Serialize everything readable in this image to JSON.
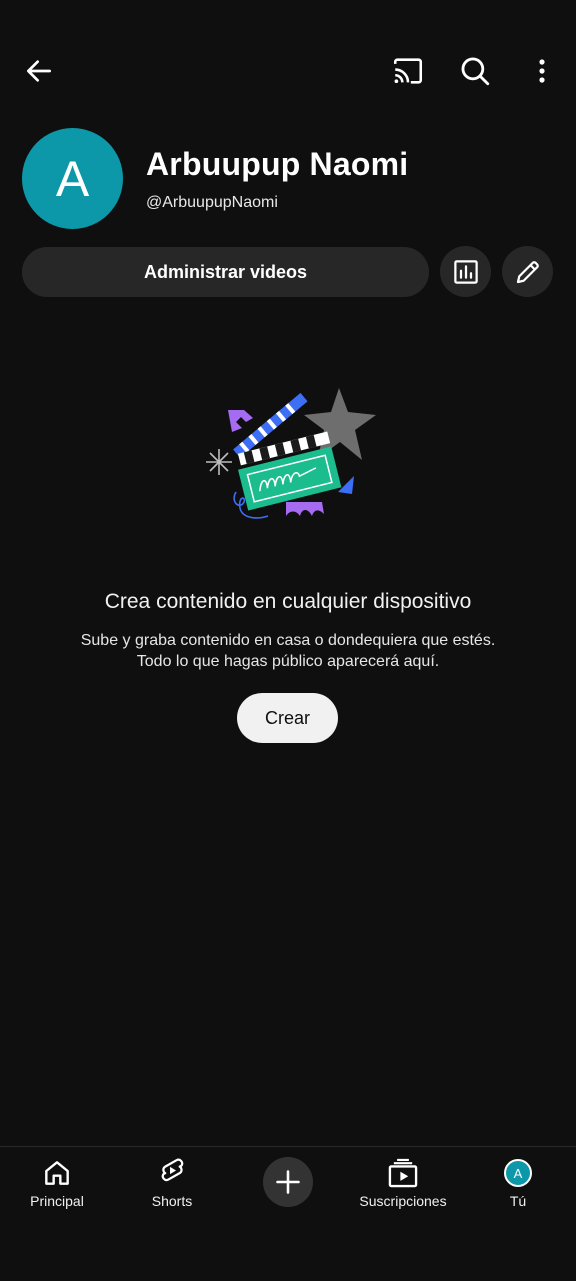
{
  "channel": {
    "avatar_letter": "A",
    "name": "Arbuupup Naomi",
    "handle": "@ArbuupupNaomi"
  },
  "actions": {
    "manage_label": "Administrar videos"
  },
  "empty_state": {
    "title": "Crea contenido en cualquier dispositivo",
    "line1": "Sube y graba contenido en casa o dondequiera que estés.",
    "line2": "Todo lo que hagas público aparecerá aquí.",
    "create_label": "Crear"
  },
  "nav": {
    "home": "Principal",
    "shorts": "Shorts",
    "subscriptions": "Suscripciones",
    "you": "Tú",
    "you_avatar_letter": "A"
  },
  "colors": {
    "background": "#0f0f0f",
    "avatar": "#0c98a8",
    "button_bg": "#272727",
    "create_bg": "#f1f1f1"
  }
}
